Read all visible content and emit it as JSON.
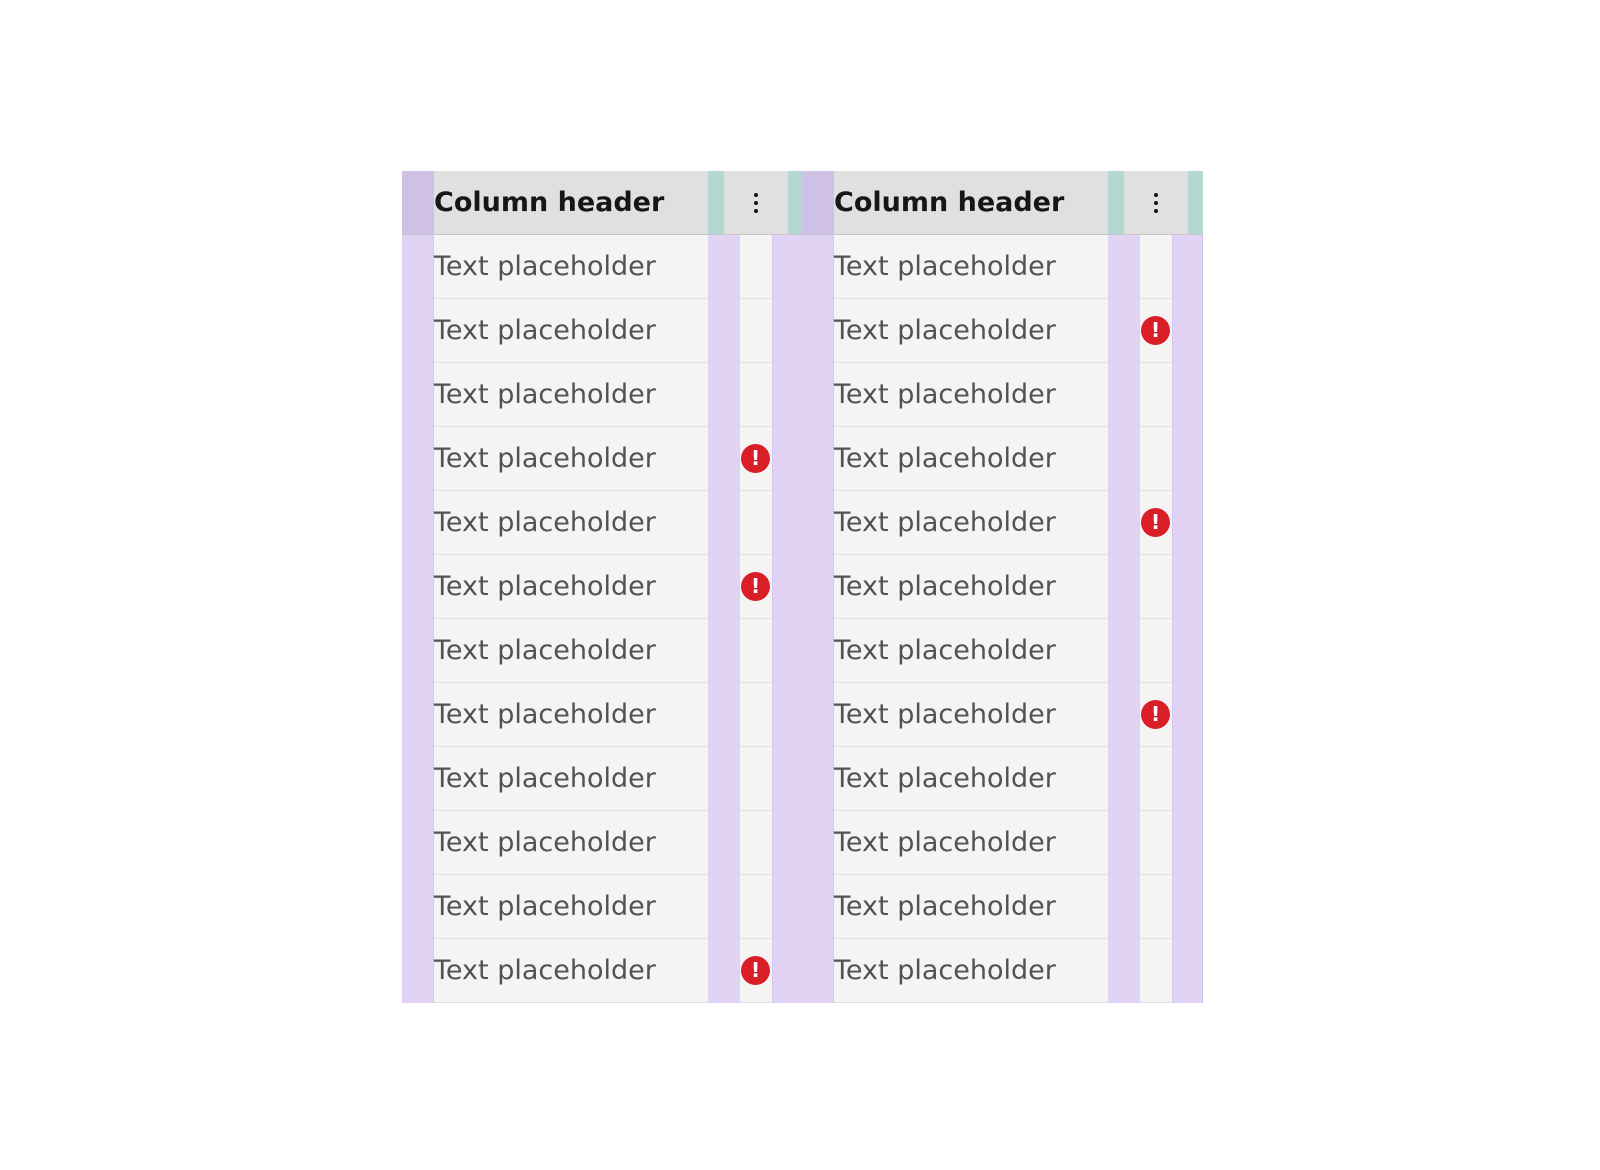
{
  "columns": [
    {
      "header": "Column header",
      "menu_icon": "overflow-menu-vertical-icon",
      "rows": [
        {
          "text": "Text placeholder",
          "warning": false
        },
        {
          "text": "Text placeholder",
          "warning": false
        },
        {
          "text": "Text placeholder",
          "warning": false
        },
        {
          "text": "Text placeholder",
          "warning": true
        },
        {
          "text": "Text placeholder",
          "warning": false
        },
        {
          "text": "Text placeholder",
          "warning": true
        },
        {
          "text": "Text placeholder",
          "warning": false
        },
        {
          "text": "Text placeholder",
          "warning": false
        },
        {
          "text": "Text placeholder",
          "warning": false
        },
        {
          "text": "Text placeholder",
          "warning": false
        },
        {
          "text": "Text placeholder",
          "warning": false
        },
        {
          "text": "Text placeholder",
          "warning": true
        }
      ]
    },
    {
      "header": "Column header",
      "menu_icon": "overflow-menu-vertical-icon",
      "rows": [
        {
          "text": "Text placeholder",
          "warning": false
        },
        {
          "text": "Text placeholder",
          "warning": true
        },
        {
          "text": "Text placeholder",
          "warning": false
        },
        {
          "text": "Text placeholder",
          "warning": false
        },
        {
          "text": "Text placeholder",
          "warning": true
        },
        {
          "text": "Text placeholder",
          "warning": false
        },
        {
          "text": "Text placeholder",
          "warning": false
        },
        {
          "text": "Text placeholder",
          "warning": true
        },
        {
          "text": "Text placeholder",
          "warning": false
        },
        {
          "text": "Text placeholder",
          "warning": false
        },
        {
          "text": "Text placeholder",
          "warning": false
        },
        {
          "text": "Text placeholder",
          "warning": false
        }
      ]
    }
  ],
  "warning_icon": "warning-filled-icon",
  "colors": {
    "header_bg": "#e0e0e0",
    "cell_bg": "#f4f4f4",
    "padding_highlight": "#e0d3f4",
    "header_padding_highlight": "#cfc1e6",
    "header_spacing_highlight": "#b2d8d4",
    "warning": "#da1e28"
  }
}
